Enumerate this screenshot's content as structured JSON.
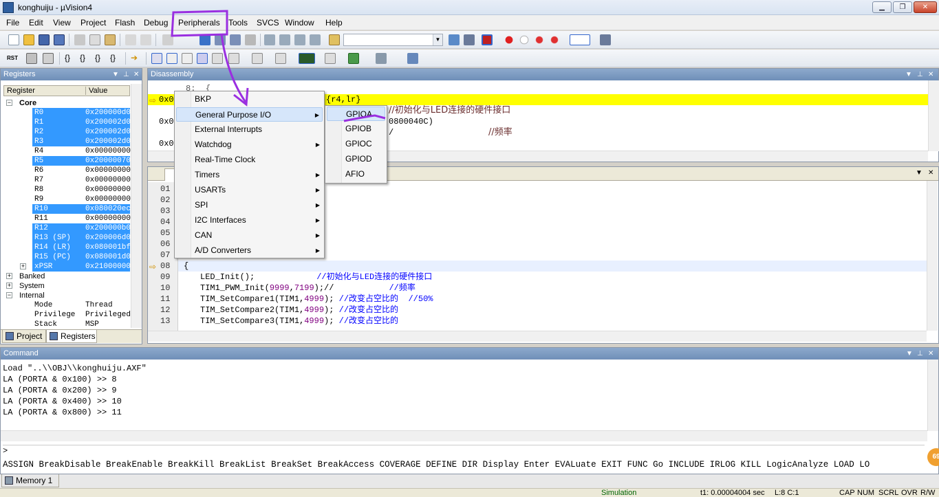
{
  "window": {
    "title": "konghuiju - µVision4"
  },
  "menubar": [
    "File",
    "Edit",
    "View",
    "Project",
    "Flash",
    "Debug",
    "Peripherals",
    "Tools",
    "SVCS",
    "Window",
    "Help"
  ],
  "toolbar2": {
    "rst_label": "RST"
  },
  "registers": {
    "panel_title": "Registers",
    "col_register": "Register",
    "col_value": "Value",
    "core_label": "Core",
    "rows": [
      {
        "name": "R0",
        "value": "0x200000d0"
      },
      {
        "name": "R1",
        "value": "0x200002d0"
      },
      {
        "name": "R2",
        "value": "0x200002d0"
      },
      {
        "name": "R3",
        "value": "0x200002d0"
      },
      {
        "name": "R4",
        "value": "0x00000000"
      },
      {
        "name": "R5",
        "value": "0x20000070"
      },
      {
        "name": "R6",
        "value": "0x00000000"
      },
      {
        "name": "R7",
        "value": "0x00000000"
      },
      {
        "name": "R8",
        "value": "0x00000000"
      },
      {
        "name": "R9",
        "value": "0x00000000"
      },
      {
        "name": "R10",
        "value": "0x080020ec"
      },
      {
        "name": "R11",
        "value": "0x00000000"
      },
      {
        "name": "R12",
        "value": "0x200000b0"
      },
      {
        "name": "R13 (SP)",
        "value": "0x200006d0"
      },
      {
        "name": "R14 (LR)",
        "value": "0x080001bf"
      },
      {
        "name": "R15 (PC)",
        "value": "0x080001d0"
      },
      {
        "name": "xPSR",
        "value": "0x21000000"
      }
    ],
    "groups": [
      "Banked",
      "System",
      "Internal"
    ],
    "internal_rows": [
      {
        "name": "Mode",
        "value": "Thread"
      },
      {
        "name": "Privilege",
        "value": "Privileged"
      },
      {
        "name": "Stack",
        "value": "MSP"
      }
    ],
    "tab_project": "Project",
    "tab_registers": "Registers"
  },
  "disassembly": {
    "panel_title": "Disassembly",
    "line_header": "8:  {",
    "line_current_addr": "0x0",
    "line_current_tail": "{r4,lr}",
    "line2_addr": "0x0",
    "line2_tail": "0800040C)",
    "line2_comment": "//初始化与LED连接的硬件接口",
    "line3_addr": "0x0",
    "line3_tail": "/",
    "line3_comment": "//频率"
  },
  "source": {
    "line_numbers": [
      "01",
      "02",
      "03",
      "04",
      "05",
      "06",
      "07",
      "08",
      "09",
      "10",
      "11",
      "12",
      "13"
    ],
    "brace": "{",
    "l09_code": "LED_Init();",
    "l09_comment": "//初始化与LED连接的硬件接口",
    "l10_code_a": "TIM1_PWM_Init(",
    "l10_num1": "9999",
    "l10_comma": ",",
    "l10_num2": "7199",
    "l10_code_b": ");//",
    "l10_comment": "//频率",
    "l11_code_a": "TIM_SetCompare1(TIM1,",
    "l11_num": "4999",
    "l11_code_b": ");",
    "l11_comment": "//改变占空比的  //50%",
    "l12_code_a": "TIM_SetCompare2(TIM1,",
    "l12_num": "4999",
    "l12_code_b": ");",
    "l12_comment": "//改变占空比的",
    "l13_code_a": "TIM_SetCompare3(TIM1,",
    "l13_num": "4999",
    "l13_code_b": ");",
    "l13_comment": "//改变占空比的"
  },
  "command": {
    "panel_title": "Command",
    "lines": [
      "Load \"..\\\\OBJ\\\\konghuiju.AXF\"",
      "LA (PORTA & 0x100) >> 8",
      "LA (PORTA & 0x200) >> 9",
      "LA (PORTA & 0x400) >> 10",
      "LA (PORTA & 0x800) >> 11"
    ],
    "prompt": ">",
    "hint": "ASSIGN BreakDisable BreakEnable BreakKill BreakList BreakSet BreakAccess COVERAGE DEFINE DIR Display Enter EVALuate EXIT FUNC Go INCLUDE IRLOG KILL LogicAnalyze LOAD LO"
  },
  "memory_tab": "Memory 1",
  "statusbar": {
    "mode": "Simulation",
    "time": "t1: 0.00004004 sec",
    "pos": "L:8 C:1",
    "flags": [
      "CAP",
      "NUM",
      "SCRL",
      "OVR",
      "R/W"
    ]
  },
  "badge": "69",
  "peripherals_menu": {
    "items": [
      {
        "label": "BKP",
        "submenu": false
      },
      {
        "label": "General Purpose I/O",
        "submenu": true
      },
      {
        "label": "External Interrupts",
        "submenu": false
      },
      {
        "label": "Watchdog",
        "submenu": true
      },
      {
        "label": "Real-Time Clock",
        "submenu": false
      },
      {
        "label": "Timers",
        "submenu": true
      },
      {
        "label": "USARTs",
        "submenu": true
      },
      {
        "label": "SPI",
        "submenu": true
      },
      {
        "label": "I2C Interfaces",
        "submenu": true
      },
      {
        "label": "CAN",
        "submenu": true
      },
      {
        "label": "A/D Converters",
        "submenu": true
      }
    ],
    "gpio_submenu": [
      "GPIOA",
      "GPIOB",
      "GPIOC",
      "GPIOD",
      "AFIO"
    ]
  },
  "colors": {
    "selection": "#3399ff",
    "current_line": "#ffff00",
    "annotation": "#9a2fe0",
    "comment": "#0000ff",
    "number": "#800080"
  }
}
